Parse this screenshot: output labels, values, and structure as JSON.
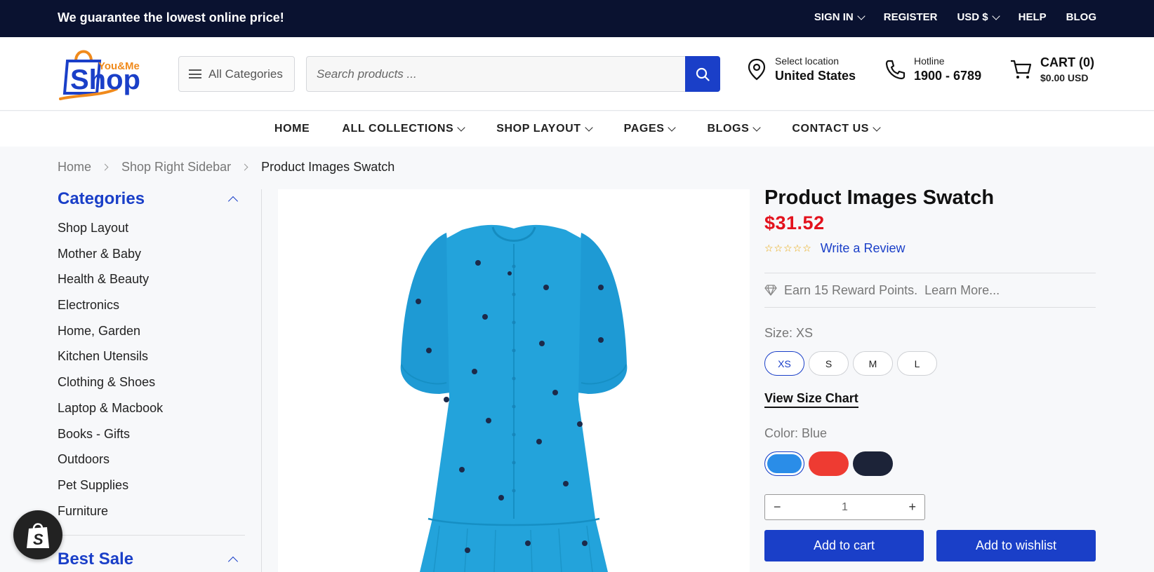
{
  "topbar": {
    "promo": "We guarantee the lowest online price!",
    "sign_in": "SIGN IN",
    "register": "REGISTER",
    "currency": "USD $",
    "help": "HELP",
    "blog": "BLOG"
  },
  "header": {
    "logo_top": "You&Me",
    "logo_main": "Shop",
    "all_categories": "All Categories",
    "search_placeholder": "Search products ...",
    "location_label": "Select location",
    "location_value": "United States",
    "hotline_label": "Hotline",
    "hotline_value": "1900 - 6789",
    "cart_label": "CART (0)",
    "cart_total": "$0.00 USD"
  },
  "mainnav": [
    "HOME",
    "ALL COLLECTIONS",
    "SHOP LAYOUT",
    "PAGES",
    "BLOGS",
    "CONTACT US"
  ],
  "breadcrumb": [
    "Home",
    "Shop Right Sidebar",
    "Product Images Swatch"
  ],
  "sidebar": {
    "title": "Categories",
    "items": [
      "Shop Layout",
      "Mother & Baby",
      "Health & Beauty",
      "Electronics",
      "Home, Garden",
      "Kitchen Utensils",
      "Clothing & Shoes",
      "Laptop & Macbook",
      "Books - Gifts",
      "Outdoors",
      "Pet Supplies",
      "Furniture"
    ],
    "second_title": "Best Sale"
  },
  "product": {
    "title": "Product Images Swatch",
    "price": "$31.52",
    "rating_stars": 0,
    "write_review": "Write a Review",
    "reward": "Earn 15 Reward Points.",
    "learn_more": "Learn More...",
    "size_label": "Size: XS",
    "sizes": [
      "XS",
      "S",
      "M",
      "L"
    ],
    "size_chart": "View Size Chart",
    "color_label": "Color: Blue",
    "colors": [
      "#2a8de8",
      "#ee3b32",
      "#1c2338"
    ],
    "qty_minus": "−",
    "qty_value": "1",
    "qty_plus": "+",
    "add_to_cart": "Add to cart",
    "add_to_wishlist": "Add to wishlist"
  }
}
